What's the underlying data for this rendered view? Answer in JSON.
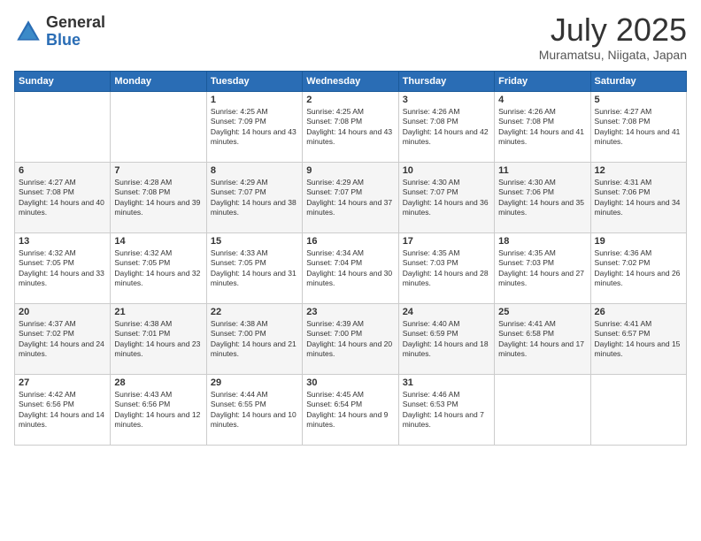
{
  "logo": {
    "general": "General",
    "blue": "Blue"
  },
  "title": {
    "month_year": "July 2025",
    "location": "Muramatsu, Niigata, Japan"
  },
  "headers": [
    "Sunday",
    "Monday",
    "Tuesday",
    "Wednesday",
    "Thursday",
    "Friday",
    "Saturday"
  ],
  "weeks": [
    [
      {
        "day": "",
        "content": ""
      },
      {
        "day": "",
        "content": ""
      },
      {
        "day": "1",
        "content": "Sunrise: 4:25 AM\nSunset: 7:09 PM\nDaylight: 14 hours and 43 minutes."
      },
      {
        "day": "2",
        "content": "Sunrise: 4:25 AM\nSunset: 7:08 PM\nDaylight: 14 hours and 43 minutes."
      },
      {
        "day": "3",
        "content": "Sunrise: 4:26 AM\nSunset: 7:08 PM\nDaylight: 14 hours and 42 minutes."
      },
      {
        "day": "4",
        "content": "Sunrise: 4:26 AM\nSunset: 7:08 PM\nDaylight: 14 hours and 41 minutes."
      },
      {
        "day": "5",
        "content": "Sunrise: 4:27 AM\nSunset: 7:08 PM\nDaylight: 14 hours and 41 minutes."
      }
    ],
    [
      {
        "day": "6",
        "content": "Sunrise: 4:27 AM\nSunset: 7:08 PM\nDaylight: 14 hours and 40 minutes."
      },
      {
        "day": "7",
        "content": "Sunrise: 4:28 AM\nSunset: 7:08 PM\nDaylight: 14 hours and 39 minutes."
      },
      {
        "day": "8",
        "content": "Sunrise: 4:29 AM\nSunset: 7:07 PM\nDaylight: 14 hours and 38 minutes."
      },
      {
        "day": "9",
        "content": "Sunrise: 4:29 AM\nSunset: 7:07 PM\nDaylight: 14 hours and 37 minutes."
      },
      {
        "day": "10",
        "content": "Sunrise: 4:30 AM\nSunset: 7:07 PM\nDaylight: 14 hours and 36 minutes."
      },
      {
        "day": "11",
        "content": "Sunrise: 4:30 AM\nSunset: 7:06 PM\nDaylight: 14 hours and 35 minutes."
      },
      {
        "day": "12",
        "content": "Sunrise: 4:31 AM\nSunset: 7:06 PM\nDaylight: 14 hours and 34 minutes."
      }
    ],
    [
      {
        "day": "13",
        "content": "Sunrise: 4:32 AM\nSunset: 7:05 PM\nDaylight: 14 hours and 33 minutes."
      },
      {
        "day": "14",
        "content": "Sunrise: 4:32 AM\nSunset: 7:05 PM\nDaylight: 14 hours and 32 minutes."
      },
      {
        "day": "15",
        "content": "Sunrise: 4:33 AM\nSunset: 7:05 PM\nDaylight: 14 hours and 31 minutes."
      },
      {
        "day": "16",
        "content": "Sunrise: 4:34 AM\nSunset: 7:04 PM\nDaylight: 14 hours and 30 minutes."
      },
      {
        "day": "17",
        "content": "Sunrise: 4:35 AM\nSunset: 7:03 PM\nDaylight: 14 hours and 28 minutes."
      },
      {
        "day": "18",
        "content": "Sunrise: 4:35 AM\nSunset: 7:03 PM\nDaylight: 14 hours and 27 minutes."
      },
      {
        "day": "19",
        "content": "Sunrise: 4:36 AM\nSunset: 7:02 PM\nDaylight: 14 hours and 26 minutes."
      }
    ],
    [
      {
        "day": "20",
        "content": "Sunrise: 4:37 AM\nSunset: 7:02 PM\nDaylight: 14 hours and 24 minutes."
      },
      {
        "day": "21",
        "content": "Sunrise: 4:38 AM\nSunset: 7:01 PM\nDaylight: 14 hours and 23 minutes."
      },
      {
        "day": "22",
        "content": "Sunrise: 4:38 AM\nSunset: 7:00 PM\nDaylight: 14 hours and 21 minutes."
      },
      {
        "day": "23",
        "content": "Sunrise: 4:39 AM\nSunset: 7:00 PM\nDaylight: 14 hours and 20 minutes."
      },
      {
        "day": "24",
        "content": "Sunrise: 4:40 AM\nSunset: 6:59 PM\nDaylight: 14 hours and 18 minutes."
      },
      {
        "day": "25",
        "content": "Sunrise: 4:41 AM\nSunset: 6:58 PM\nDaylight: 14 hours and 17 minutes."
      },
      {
        "day": "26",
        "content": "Sunrise: 4:41 AM\nSunset: 6:57 PM\nDaylight: 14 hours and 15 minutes."
      }
    ],
    [
      {
        "day": "27",
        "content": "Sunrise: 4:42 AM\nSunset: 6:56 PM\nDaylight: 14 hours and 14 minutes."
      },
      {
        "day": "28",
        "content": "Sunrise: 4:43 AM\nSunset: 6:56 PM\nDaylight: 14 hours and 12 minutes."
      },
      {
        "day": "29",
        "content": "Sunrise: 4:44 AM\nSunset: 6:55 PM\nDaylight: 14 hours and 10 minutes."
      },
      {
        "day": "30",
        "content": "Sunrise: 4:45 AM\nSunset: 6:54 PM\nDaylight: 14 hours and 9 minutes."
      },
      {
        "day": "31",
        "content": "Sunrise: 4:46 AM\nSunset: 6:53 PM\nDaylight: 14 hours and 7 minutes."
      },
      {
        "day": "",
        "content": ""
      },
      {
        "day": "",
        "content": ""
      }
    ]
  ]
}
